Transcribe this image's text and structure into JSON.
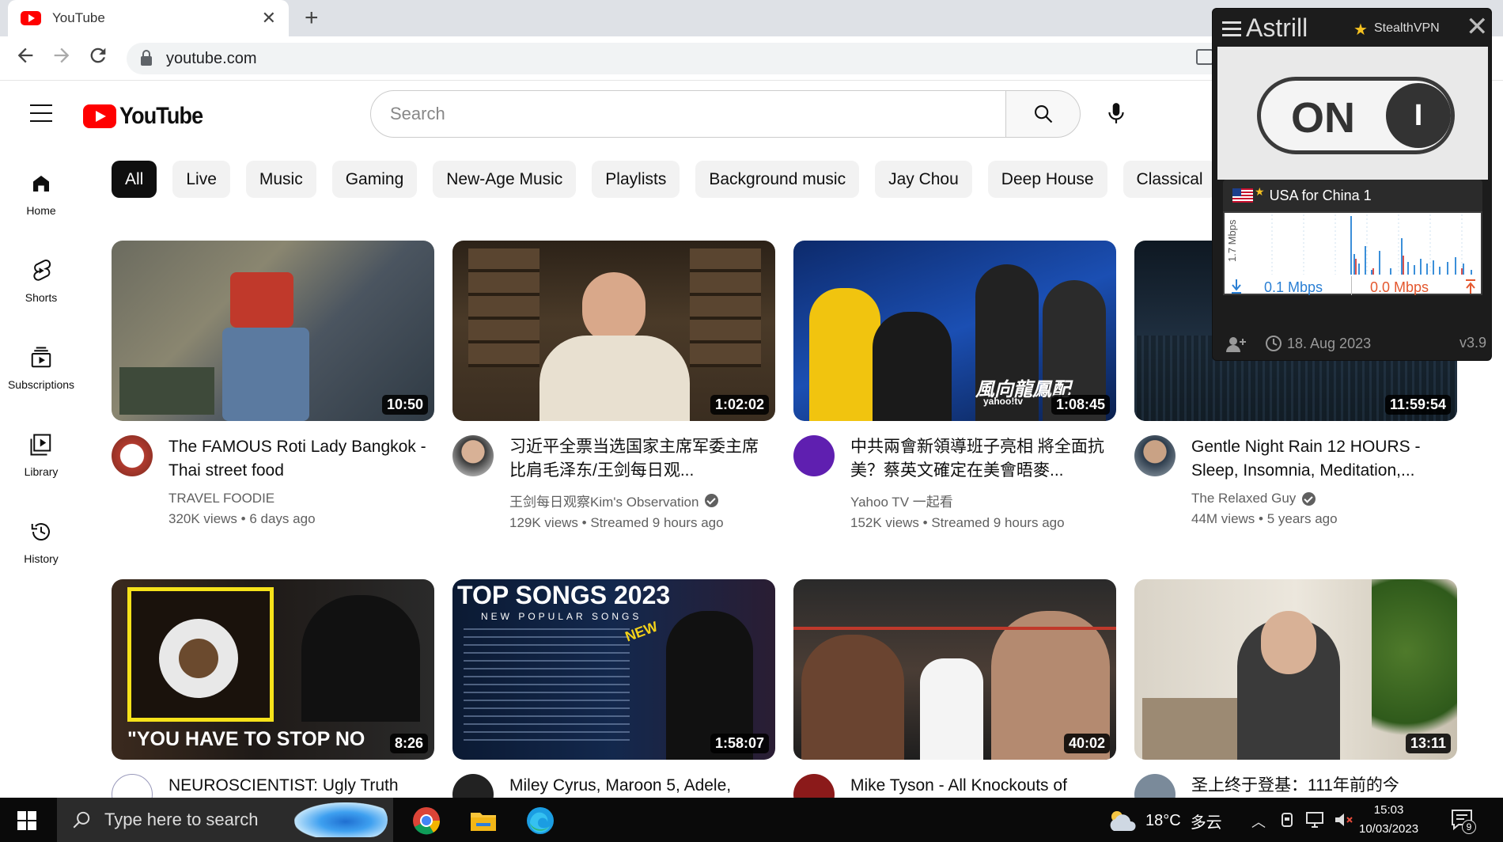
{
  "browser": {
    "tab_title": "YouTube",
    "tab_close": "✕",
    "new_tab": "+",
    "url": "youtube.com"
  },
  "header": {
    "logo_text": "YouTube",
    "search_placeholder": "Search"
  },
  "chips": [
    "All",
    "Live",
    "Music",
    "Gaming",
    "New-Age Music",
    "Playlists",
    "Background music",
    "Jay Chou",
    "Deep House",
    "Classical"
  ],
  "sidebar": [
    {
      "label": "Home",
      "icon": "home-icon"
    },
    {
      "label": "Shorts",
      "icon": "shorts-icon"
    },
    {
      "label": "Subscriptions",
      "icon": "subscriptions-icon"
    },
    {
      "label": "Library",
      "icon": "library-icon"
    },
    {
      "label": "History",
      "icon": "history-icon"
    }
  ],
  "videos": [
    {
      "title": "The FAMOUS Roti Lady Bangkok - Thai street food",
      "channel": "TRAVEL FOODIE",
      "verified": false,
      "views": "320K views",
      "age": "6 days ago",
      "duration": "10:50"
    },
    {
      "title": "习近平全票当选国家主席军委主席 比肩毛泽东/王剑每日观...",
      "channel": "王剑每日观察Kim's Observation",
      "verified": true,
      "views": "129K views",
      "age": "Streamed 9 hours ago",
      "duration": "1:02:02"
    },
    {
      "title": "中共兩會新領導班子亮相 將全面抗美？蔡英文確定在美會晤麥...",
      "channel": "Yahoo TV 一起看",
      "verified": false,
      "views": "152K views",
      "age": "Streamed 9 hours ago",
      "duration": "1:08:45"
    },
    {
      "title": "Gentle Night Rain 12 HOURS - Sleep, Insomnia, Meditation,...",
      "channel": "The Relaxed Guy",
      "verified": true,
      "views": "44M views",
      "age": "5 years ago",
      "duration": "11:59:54"
    },
    {
      "title": "NEUROSCIENTIST: Ugly Truth",
      "duration": "8:26",
      "thumb_text": "\"YOU HAVE TO STOP NO"
    },
    {
      "title": "Miley Cyrus, Maroon 5, Adele,",
      "duration": "1:58:07",
      "thumb_text": "TOP SONGS 2023",
      "thumb_sub": "NEW POPULAR SONGS",
      "thumb_badge": "NEW"
    },
    {
      "title": "Mike Tyson - All Knockouts of",
      "duration": "40:02"
    },
    {
      "title": "圣上终于登基：111年前的今",
      "duration": "13:11"
    }
  ],
  "thumb_overlays": {
    "news_caption": "風向龍鳳配",
    "news_logo": "yahoo!tv"
  },
  "astrill": {
    "brand": "Astrill",
    "protocol": "StealthVPN",
    "state": "ON",
    "knob": "I",
    "server": "USA for China 1",
    "graph_label": "1.7 Mbps",
    "download": "0.1 Mbps",
    "upload": "0.0 Mbps",
    "date": "18. Aug 2023",
    "version": "v3.9"
  },
  "taskbar": {
    "search_placeholder": "Type here to search",
    "temperature": "18°C",
    "weather": "多云",
    "time": "15:03",
    "date": "10/03/2023",
    "notifications": "9"
  },
  "colors": {
    "brand_red": "#ff0000",
    "chip_active": "#0f0f0f",
    "chip_bg": "#f2f2f2",
    "astrill_dark": "#1c1c1c"
  }
}
